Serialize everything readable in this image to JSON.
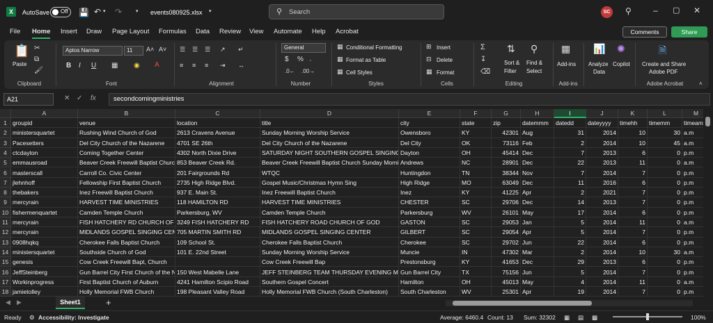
{
  "titlebar": {
    "app_icon": "X",
    "autosave_label": "AutoSave",
    "autosave_state": "Off",
    "filename": "events080925.xlsx",
    "search_placeholder": "Search",
    "avatar_initials": "SC"
  },
  "menu": [
    "File",
    "Home",
    "Insert",
    "Draw",
    "Page Layout",
    "Formulas",
    "Data",
    "Review",
    "View",
    "Automate",
    "Help",
    "Acrobat"
  ],
  "active_menu": "Home",
  "comments_label": "Comments",
  "share_label": "Share",
  "ribbon": {
    "clipboard": {
      "paste": "Paste",
      "group": "Clipboard"
    },
    "font": {
      "name": "Aptos Narrow",
      "size": "11",
      "group": "Font"
    },
    "alignment": {
      "group": "Alignment"
    },
    "number": {
      "format": "General",
      "group": "Number"
    },
    "styles": {
      "cond": "Conditional Formatting",
      "table": "Format as Table",
      "cell": "Cell Styles",
      "group": "Styles"
    },
    "cells": {
      "insert": "Insert",
      "delete": "Delete",
      "format": "Format",
      "group": "Cells"
    },
    "editing": {
      "sort1": "Sort &",
      "sort2": "Filter",
      "find1": "Find &",
      "find2": "Select",
      "group": "Editing"
    },
    "addins": {
      "label": "Add-ins",
      "group": "Add-ins"
    },
    "analyze": {
      "l1": "Analyze",
      "l2": "Data"
    },
    "copilot": {
      "label": "Copilot"
    },
    "acrobat": {
      "l1": "Create and Share",
      "l2": "Adobe PDF",
      "group": "Adobe Acrobat"
    }
  },
  "formula_bar": {
    "namebox": "A21",
    "fx": "fx",
    "value": "secondcomingministries"
  },
  "columns": [
    "A",
    "B",
    "C",
    "D",
    "E",
    "F",
    "G",
    "H",
    "I",
    "J",
    "K",
    "L",
    "M"
  ],
  "selected_column": "I",
  "rows": [
    [
      "groupid",
      "venue",
      "location",
      "title",
      "city",
      "state",
      "zip",
      "datemmm",
      "datedd",
      "dateyyyy",
      "timehh",
      "timemm",
      "timeam"
    ],
    [
      "ministersquartet",
      "Rushing Wind Church of God",
      "2613 Cravens Avenue",
      "Sunday Morning Worship Service",
      "Owensboro",
      "KY",
      "42301",
      "Aug",
      "31",
      "2014",
      "10",
      "30",
      "a.m"
    ],
    [
      "Pacesetters",
      "Del City Church of the Nazarene",
      "4701 SE 26th",
      "Del City Church of the Nazarene",
      "Del City",
      "OK",
      "73116",
      "Feb",
      "2",
      "2014",
      "10",
      "45",
      "a.m"
    ],
    [
      "ctcdayton",
      "Coming Together Center",
      "4302 North Dixie Drive",
      "SATURDAY NIGHT SOUTHERN GOSPEL SINGING",
      "Dayton",
      "OH",
      "45414",
      "Dec",
      "7",
      "2013",
      "6",
      "0",
      "p.m"
    ],
    [
      "emmausroad",
      "Beaver Creek Freewill Baptist Church",
      "853 Beaver Creek Rd.",
      "Beaver Creek Freewill Baptist Church Sunday Morning",
      "Andrews",
      "NC",
      "28901",
      "Dec",
      "22",
      "2013",
      "11",
      "0",
      "a.m"
    ],
    [
      "masterscall",
      "Carroll Co. Civic Center",
      "201 Fairgrounds Rd",
      "WTQC",
      "Huntingdon",
      "TN",
      "38344",
      "Nov",
      "7",
      "2014",
      "7",
      "0",
      "p.m"
    ],
    [
      "jlehnhoff",
      "Fellowship First Baptist Church",
      "2735 High Ridge Blvd.",
      "Gospel Music/Christmas Hymn Sing",
      "High Ridge",
      "MO",
      "63049",
      "Dec",
      "11",
      "2016",
      "6",
      "0",
      "p.m"
    ],
    [
      "thebakers",
      "Inez Freewill Baptist Church",
      "937 E. Main St.",
      "Inez Freewill Baptist Church",
      "Inez",
      "KY",
      "41225",
      "Apr",
      "2",
      "2021",
      "7",
      "0",
      "p.m"
    ],
    [
      "mercyrain",
      "HARVEST TIME MINISTRIES",
      "118 HAMILTON RD",
      "HARVEST TIME MINISTRIES",
      "CHESTER",
      "SC",
      "29706",
      "Dec",
      "14",
      "2013",
      "7",
      "0",
      "p.m"
    ],
    [
      "fishermenquartet",
      "Camden Temple Church",
      "Parkersburg, WV",
      "Camden Temple Church",
      "Parkersburg",
      "WV",
      "26101",
      "May",
      "17",
      "2014",
      "6",
      "0",
      "p.m"
    ],
    [
      "mercyrain",
      "FISH HATCHERY RD CHURCH OF GOD",
      "3249 FISH HATCHERY RD",
      "FISH HATCHERY ROAD CHURCH OF GOD",
      "GASTON",
      "SC",
      "29053",
      "Jan",
      "5",
      "2014",
      "11",
      "0",
      "a.m"
    ],
    [
      "mercyrain",
      "MIDLANDS GOSPEL SINGING CENTER",
      "705 MARTIN SMITH RD",
      "MIDLANDS GOSPEL SINGING CENTER",
      "GILBERT",
      "SC",
      "29054",
      "Apr",
      "5",
      "2014",
      "7",
      "0",
      "p.m"
    ],
    [
      "0908hqkq",
      "Cherokee Falls Baptist Church",
      "109 School St.",
      "Cherokee Falls Baptist Church",
      "Cherokee",
      "SC",
      "29702",
      "Jun",
      "22",
      "2014",
      "6",
      "0",
      "p.m"
    ],
    [
      "ministersquartet",
      "Southside Church of God",
      "101 E. 22nd Street",
      "Sunday Morning Worship Service",
      "Muncie",
      "IN",
      "47302",
      "Mar",
      "2",
      "2014",
      "10",
      "30",
      "a.m"
    ],
    [
      "genesis",
      "Cow Creek Freewill Bapt, Church",
      "",
      "Cow Creek Freewill Bap",
      "Prestonsburg",
      "KY",
      "41653",
      "Dec",
      "29",
      "2013",
      "6",
      "0",
      "p.m"
    ],
    [
      "JeffSteinberg",
      "Gun Barrel City First Church of the Nazarene",
      "150 West Mabelle Lane",
      "JEFF STEINBERG TEAM THURSDAY EVENING MEETING",
      "Gun Barrel City",
      "TX",
      "75156",
      "Jun",
      "5",
      "2014",
      "7",
      "0",
      "p.m"
    ],
    [
      "Workinprogress",
      "First Baptist Church of Auburn",
      "4241 Hamilton Scipio Road",
      "Southern Gospel Concert",
      "Hamilton",
      "OH",
      "45013",
      "May",
      "4",
      "2014",
      "11",
      "0",
      "a.m"
    ],
    [
      "jamietolley",
      "Holly Memorial FWB Church",
      "198 Pleasant Valley Road",
      "Holly Memorial FWB Church (South Charleston)",
      "South Charleston",
      "WV",
      "25301",
      "Apr",
      "19",
      "2014",
      "7",
      "0",
      "p.m"
    ]
  ],
  "sheet_tab": "Sheet1",
  "status": {
    "ready": "Ready",
    "accessibility": "Accessibility: Investigate",
    "average": "Average: 6460.4",
    "count": "Count: 13",
    "sum": "Sum: 32302",
    "zoom": "100%"
  }
}
